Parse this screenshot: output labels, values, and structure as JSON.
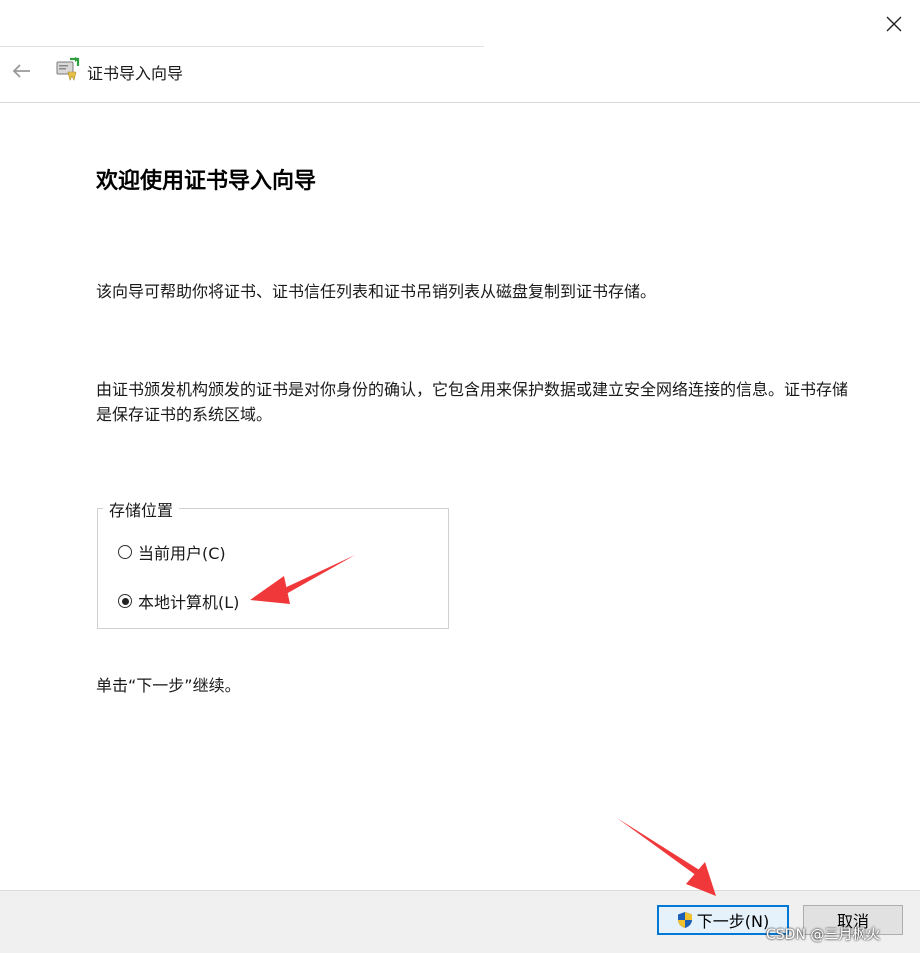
{
  "window": {
    "close_label": "close"
  },
  "nav": {
    "title": "证书导入向导"
  },
  "content": {
    "heading": "欢迎使用证书导入向导",
    "paragraph1": "该向导可帮助你将证书、证书信任列表和证书吊销列表从磁盘复制到证书存储。",
    "paragraph2": "由证书颁发机构颁发的证书是对你身份的确认，它包含用来保护数据或建立安全网络连接的信息。证书存储是保存证书的系统区域。",
    "store_location": {
      "legend": "存储位置",
      "options": [
        {
          "label": "当前用户(C)",
          "selected": false
        },
        {
          "label": "本地计算机(L)",
          "selected": true
        }
      ]
    },
    "hint": "单击“下一步”继续。"
  },
  "footer": {
    "next_label": "下一步(N)",
    "cancel_label": "取消"
  },
  "watermark": "CSDN @三月枫火",
  "colors": {
    "accent": "#0078d7",
    "annotation_arrow": "#f0383b",
    "footer_bg": "#f0f0f0"
  }
}
